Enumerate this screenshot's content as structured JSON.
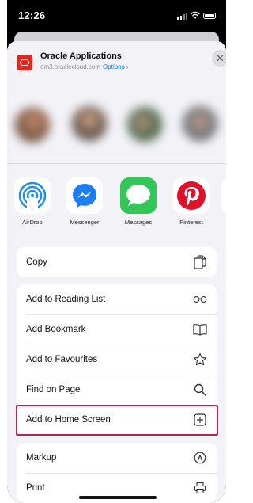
{
  "status_bar": {
    "time": "12:26"
  },
  "share_header": {
    "title": "Oracle Applications",
    "subtitle": "em3.oraclecloud.com",
    "options_label": "Options ›",
    "close_icon": "close-icon"
  },
  "apps": [
    {
      "label": "AirDrop",
      "icon": "airdrop-icon"
    },
    {
      "label": "Messenger",
      "icon": "messenger-icon"
    },
    {
      "label": "Messages",
      "icon": "messages-icon"
    },
    {
      "label": "Pinterest",
      "icon": "pinterest-icon"
    }
  ],
  "actions_top": [
    {
      "label": "Copy",
      "icon": "copy-icon"
    }
  ],
  "actions_main": [
    {
      "label": "Add to Reading List",
      "icon": "glasses-icon"
    },
    {
      "label": "Add Bookmark",
      "icon": "book-icon"
    },
    {
      "label": "Add to Favourites",
      "icon": "star-icon"
    },
    {
      "label": "Find on Page",
      "icon": "search-icon"
    },
    {
      "label": "Add to Home Screen",
      "icon": "add-square-icon",
      "highlighted": true
    }
  ],
  "actions_bottom": [
    {
      "label": "Markup",
      "icon": "markup-icon"
    },
    {
      "label": "Print",
      "icon": "printer-icon"
    }
  ],
  "colors": {
    "highlight_border": "#b3244f",
    "link_blue": "#007aff",
    "oracle_red": "#e22620",
    "sheet_bg": "#f2f2f7"
  }
}
